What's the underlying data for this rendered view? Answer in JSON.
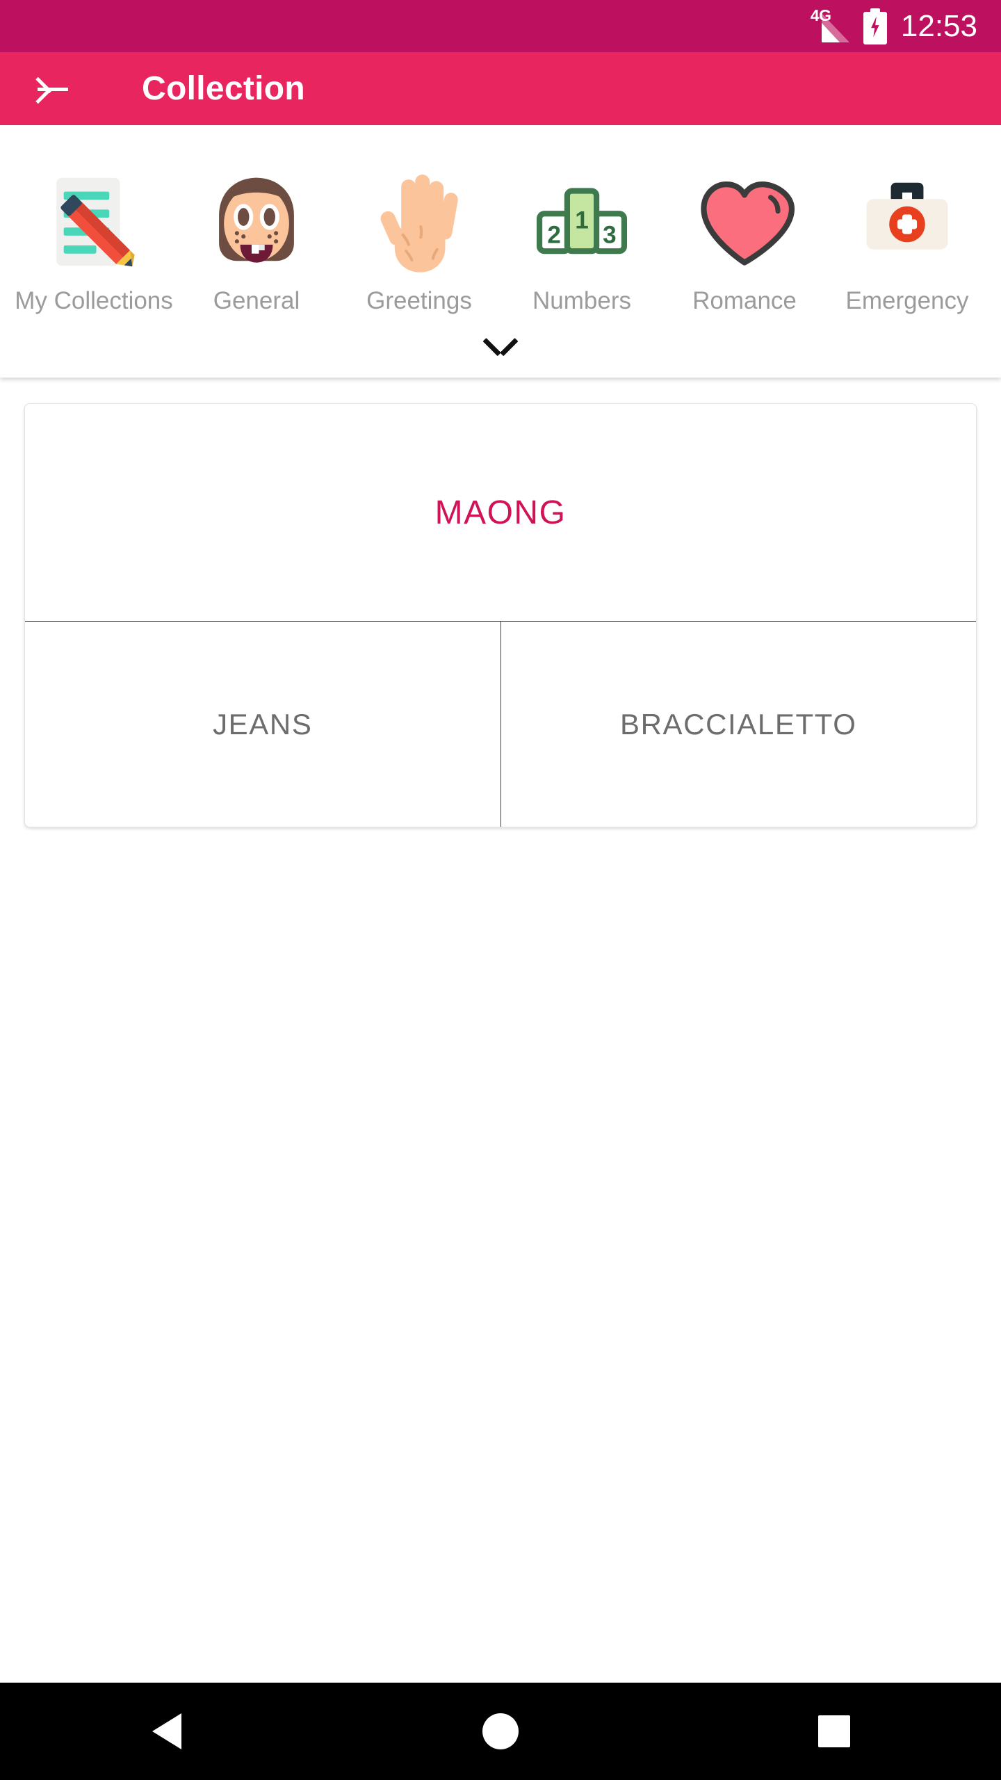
{
  "status_bar": {
    "network_label": "4G",
    "signal_icon": "signal-bars-icon",
    "battery_icon": "battery-charging-icon",
    "time": "12:53",
    "background_color": "#bd1160"
  },
  "app_bar": {
    "back_icon": "arrow-back-icon",
    "title": "Collection",
    "background_color": "#e8255f",
    "text_color": "#ffffff"
  },
  "categories": {
    "expand_icon": "chevron-down-icon",
    "items": [
      {
        "label": "My Collections",
        "icon": "memo-emoji",
        "glyph": "📝"
      },
      {
        "label": "General",
        "icon": "girl-face-emoji",
        "glyph": "👧"
      },
      {
        "label": "Greetings",
        "icon": "raised-hand-emoji",
        "glyph": "🖐"
      },
      {
        "label": "Numbers",
        "icon": "podium-emoji",
        "glyph": "🏆"
      },
      {
        "label": "Romance",
        "icon": "heart-emoji",
        "glyph": "❤"
      },
      {
        "label": "Emergency",
        "icon": "first-aid-kit-emoji",
        "glyph": "🚑"
      }
    ]
  },
  "card": {
    "headword": "MAONG",
    "headword_color": "#cf1356",
    "translations": [
      {
        "label": "JEANS"
      },
      {
        "label": "BRACCIALETTO"
      }
    ],
    "translation_color": "#6d6d6d"
  },
  "nav_bar": {
    "back_icon": "nav-back-triangle-icon",
    "home_icon": "nav-home-circle-icon",
    "recents_icon": "nav-recents-square-icon",
    "background_color": "#000000"
  }
}
